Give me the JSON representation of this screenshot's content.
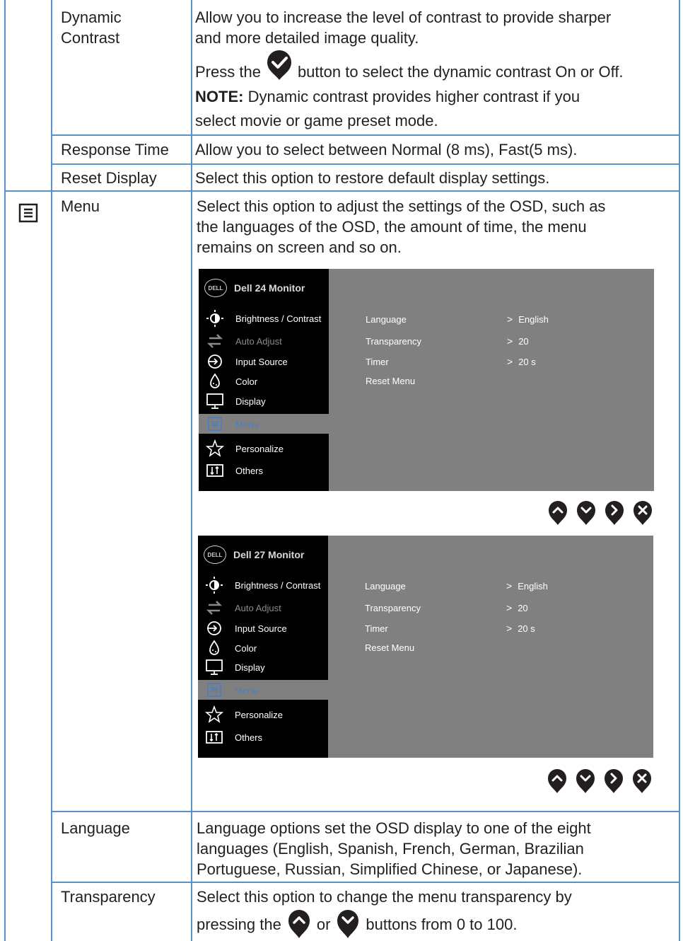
{
  "rows": {
    "dynamic_contrast": {
      "label_line1": "Dynamic",
      "label_line2": "Contrast",
      "desc_line1": "Allow you to increase the level of contrast to provide sharper",
      "desc_line2": "and more detailed image quality.",
      "press_pre": "Press the",
      "press_post": "button to select the dynamic contrast On or Off.",
      "note_label": "NOTE:",
      "note_line1": " Dynamic contrast provides higher contrast if you",
      "note_line2": "select movie or game preset mode."
    },
    "response_time": {
      "label": "Response Time",
      "desc": "Allow you to select between Normal (8 ms), Fast(5 ms)."
    },
    "reset_display": {
      "label": "Reset Display",
      "desc": "Select this option to restore default display settings."
    },
    "menu": {
      "icon": "menu-list-icon",
      "label": "Menu",
      "desc_line1": "Select this option to adjust the settings of the OSD, such as",
      "desc_line2": "the languages of the OSD, the amount of time, the menu",
      "desc_line3": "remains on screen and so on."
    },
    "language": {
      "label": "Language",
      "desc_line1": "Language options set the OSD display to one of the eight",
      "desc_line2": "languages (English, Spanish, French, German, Brazilian",
      "desc_line3": "Portuguese, Russian, Simplified Chinese, or Japanese)."
    },
    "transparency": {
      "label": "Transparency",
      "desc_line1": "Select this option to change the menu transparency by",
      "desc_pre": "pressing the",
      "desc_or": "or",
      "desc_post": "buttons from 0 to 100."
    }
  },
  "osd_screens": [
    {
      "logo": "DELL",
      "title": "Dell 24 Monitor",
      "menu_items": [
        "Brightness / Contrast",
        "Auto Adjust",
        "Input Source",
        "Color",
        "Display",
        "Menu",
        "Personalize",
        "Others"
      ],
      "options": [
        "Language",
        "Transparency",
        "Timer",
        "Reset Menu"
      ],
      "values": [
        "English",
        "20",
        "20 s"
      ]
    },
    {
      "logo": "DELL",
      "title": "Dell 27 Monitor",
      "menu_items": [
        "Brightness / Contrast",
        "Auto Adjust",
        "Input Source",
        "Color",
        "Display",
        "Menu",
        "Personalize",
        "Others"
      ],
      "options": [
        "Language",
        "Transparency",
        "Timer",
        "Reset Menu"
      ],
      "values": [
        "English",
        "20",
        "20 s"
      ]
    }
  ],
  "control_buttons": [
    "up-icon",
    "down-icon",
    "right-icon",
    "close-icon"
  ],
  "colors": {
    "rule": "#5b8fc9",
    "osd_bg": "#808080",
    "osd_side": "#000000",
    "osd_selected": "#4a7dc4"
  }
}
